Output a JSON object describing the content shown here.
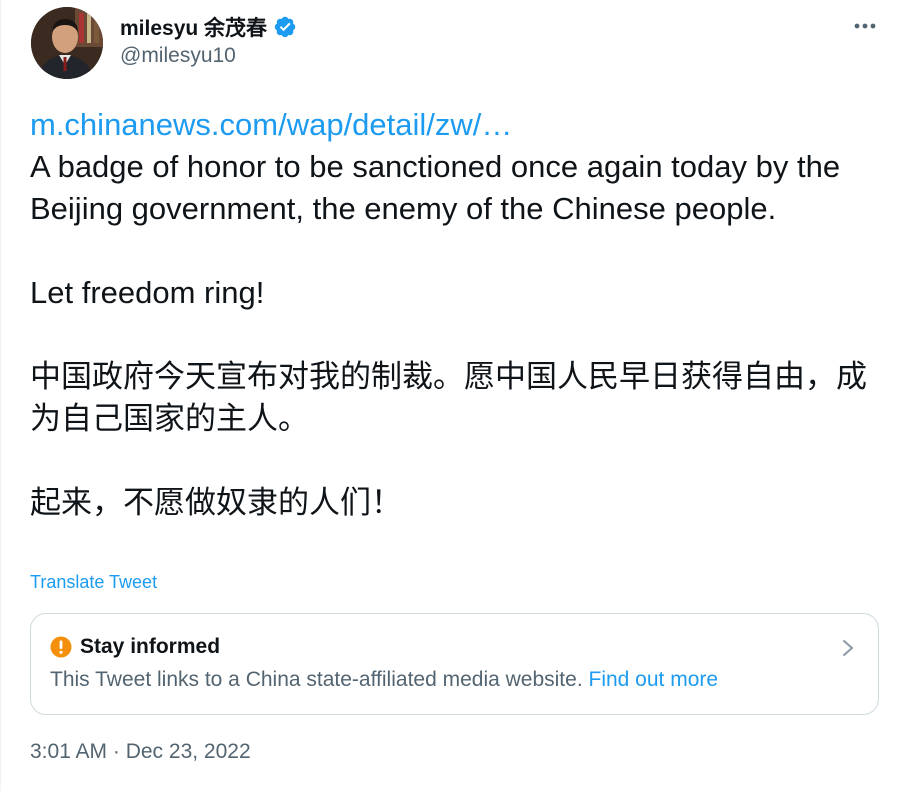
{
  "author": {
    "name": "milesyu 余茂春",
    "handle": "@milesyu10",
    "verified": true,
    "avatar_icon": "profile-photo"
  },
  "menu": {
    "icon": "more-horizontal-icon"
  },
  "tweet": {
    "link": "m.chinanews.com/wap/detail/zw/…",
    "paragraphs": [
      "A badge of honor to be sanctioned once again today by the Beijing government, the enemy of the Chinese people.",
      "Let freedom ring!",
      "中国政府今天宣布对我的制裁。愿中国人民早日获得自由，成为自己国家的主人。",
      "起来，不愿做奴隶的人们！"
    ],
    "translate_label": "Translate Tweet",
    "timestamp": "3:01 AM · Dec 23, 2022"
  },
  "notice": {
    "title": "Stay informed",
    "body": "This Tweet links to a China state-affiliated media website. ",
    "link_label": "Find out more"
  },
  "colors": {
    "accent": "#1d9bf0",
    "text": "#0f1419",
    "secondary": "#536471",
    "alert": "#f4900c"
  }
}
